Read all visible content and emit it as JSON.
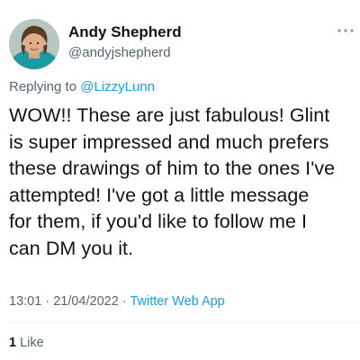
{
  "author": {
    "display_name": "Andy Shepherd",
    "handle": "@andyjshepherd",
    "avatar_icon": "profile-photo"
  },
  "more_icon": "more-dots-icon",
  "reply": {
    "prefix": "Replying to",
    "mention": "@LizzyLunn"
  },
  "tweet": {
    "lines": [
      "WOW!! These are just fabulous! Glint",
      "is super impressed and much prefers",
      "these drawings of him to the ones I've",
      "attempted! I've got a little message",
      "for them, if you'd like to follow me I",
      "can DM you it."
    ]
  },
  "meta": {
    "time": "13:01",
    "separator": "·",
    "date": "21/04/2022",
    "source": "Twitter Web App"
  },
  "stats": {
    "like_count": "1",
    "like_label": "Like"
  },
  "colors": {
    "text": "#0f1419",
    "secondary": "#536471",
    "link": "#1d9bf0",
    "divider": "#eff3f4"
  }
}
